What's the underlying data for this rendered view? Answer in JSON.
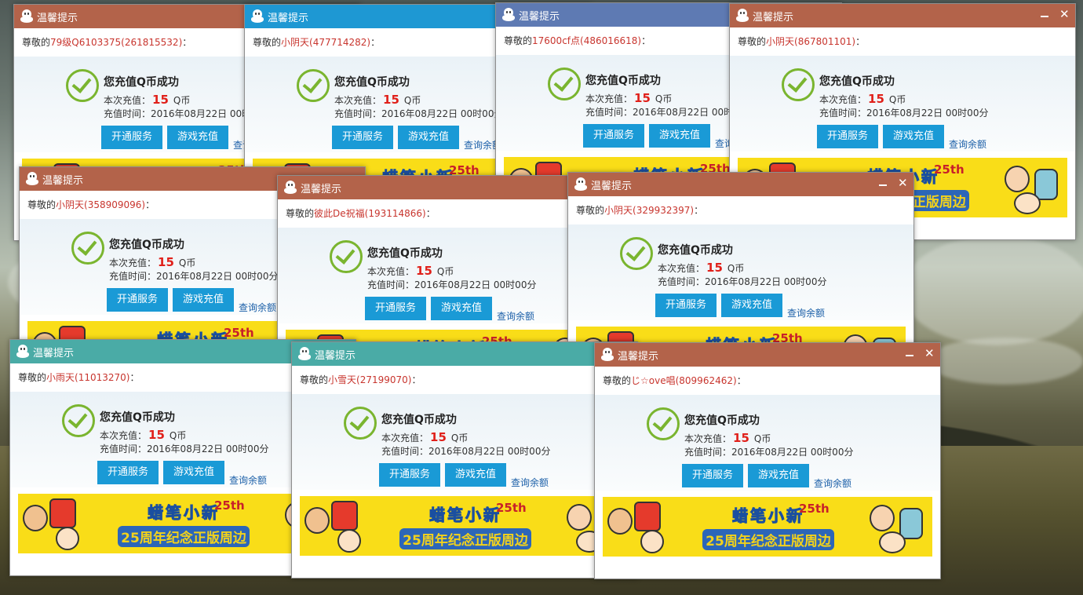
{
  "desktop": {
    "description_colors": {
      "sky": "#7b8780",
      "field": "#56522f"
    }
  },
  "colors": {
    "brown": "#b3634a",
    "blue": "#1e98d3",
    "slate": "#5e7ab3",
    "teal": "#4aaba6",
    "button": "#1a9ad6",
    "amount": "#e0201a",
    "user": "#c8352e"
  },
  "common": {
    "title": "温馨提示",
    "greet_prefix": "尊敬的",
    "greet_suffix": "：",
    "success_text": "您充值Q币成功",
    "amount_label": "本次充值：",
    "amount_value": "15",
    "amount_unit": "Q币",
    "time_label": "充值时间：",
    "time_value": "2016年08月22日 00时00分",
    "button_open": "开通服务",
    "button_game": "游戏充值",
    "link_balance": "查询余额",
    "banner_line1": "蜡笔小新",
    "banner_line2": "25周年纪念正版周边",
    "banner_badge": "25th"
  },
  "popups": [
    {
      "user": "79级Q6103375(261815532)",
      "title_color": "#b3634a",
      "controls": false
    },
    {
      "user": "小阴天(477714282)",
      "title_color": "#1e98d3",
      "controls": false
    },
    {
      "user": "17600cf点(486016618)",
      "title_color": "#5e7ab3",
      "controls": false
    },
    {
      "user": "小阴天(867801101)",
      "title_color": "#b3634a",
      "controls": true
    },
    {
      "user": "小阴天(358909096)",
      "title_color": "#b3634a",
      "controls": false
    },
    {
      "user": "彼此De祝福(193114866)",
      "title_color": "#b3634a",
      "controls": false
    },
    {
      "user": "小阴天(329932397)",
      "title_color": "#b3634a",
      "controls": true
    },
    {
      "user": "小雨天(11013270)",
      "title_color": "#4aaba6",
      "controls": false
    },
    {
      "user": "小雪天(27199070)",
      "title_color": "#4aaba6",
      "controls": false
    },
    {
      "user": "じ☆ove唱(809962462)",
      "title_color": "#b3634a",
      "controls": true
    }
  ]
}
